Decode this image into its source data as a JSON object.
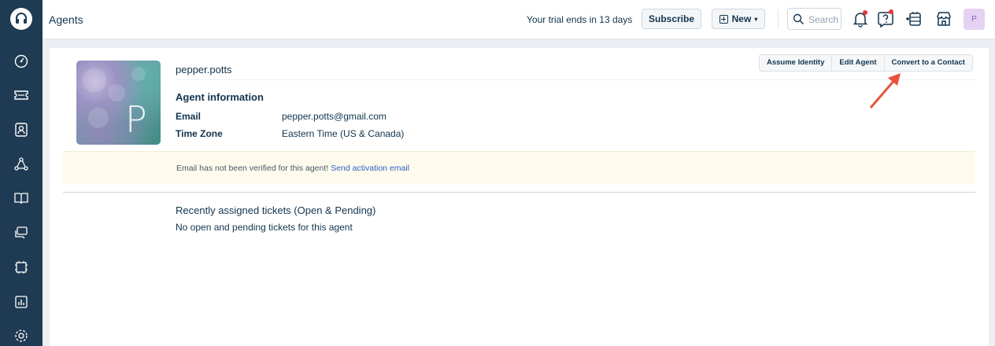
{
  "header": {
    "title": "Agents",
    "trial_text": "Your trial ends in 13 days",
    "subscribe_label": "Subscribe",
    "new_label": "New",
    "search_placeholder": "Search",
    "avatar_initial": "P"
  },
  "sidebar": {
    "items": [
      "dashboard-icon",
      "tickets-icon",
      "contacts-icon",
      "groups-icon",
      "solutions-icon",
      "forums-icon",
      "assets-icon",
      "reports-icon",
      "admin-icon"
    ]
  },
  "agent": {
    "avatar_letter": "P",
    "name": "pepper.potts",
    "section_title": "Agent information",
    "email_label": "Email",
    "email_value": "pepper.potts@gmail.com",
    "timezone_label": "Time Zone",
    "timezone_value": "Eastern Time (US & Canada)"
  },
  "actions": {
    "assume_identity": "Assume Identity",
    "edit_agent": "Edit Agent",
    "convert_contact": "Convert to a Contact"
  },
  "notice": {
    "text": "Email has not been verified for this agent!",
    "link": "Send activation email"
  },
  "recent": {
    "title": "Recently assigned tickets (Open & Pending)",
    "empty": "No open and pending tickets for this agent"
  },
  "colors": {
    "sidebar": "#1f3b53",
    "accent_link": "#2c5cc5",
    "notice_bg": "#fefbed",
    "annotation_arrow": "#e8533a"
  }
}
